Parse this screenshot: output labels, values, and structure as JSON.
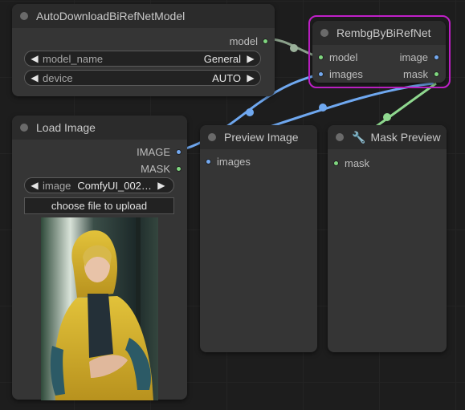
{
  "nodes": {
    "auto_download": {
      "title": "AutoDownloadBiRefNetModel",
      "outputs": [
        "model"
      ],
      "widgets": [
        {
          "label": "model_name",
          "value": "General"
        },
        {
          "label": "device",
          "value": "AUTO"
        }
      ]
    },
    "rembg": {
      "title": "RembgByBiRefNet",
      "inputs": [
        "model",
        "images"
      ],
      "outputs": [
        "image",
        "mask"
      ],
      "selected_color": "#c020c8"
    },
    "load_image": {
      "title": "Load Image",
      "outputs": [
        "IMAGE",
        "MASK"
      ],
      "widget": {
        "label": "image",
        "value": "ComfyUI_002…"
      },
      "upload_label": "choose file to upload"
    },
    "preview_image": {
      "title": "Preview Image",
      "inputs": [
        "images"
      ]
    },
    "mask_preview": {
      "title": "Mask Preview",
      "icon": "wrench-icon",
      "inputs": [
        "mask"
      ]
    }
  },
  "colors": {
    "image_link": "#6fa8f0",
    "mask_link": "#8fd88f",
    "model_link": "#9ab09a"
  }
}
